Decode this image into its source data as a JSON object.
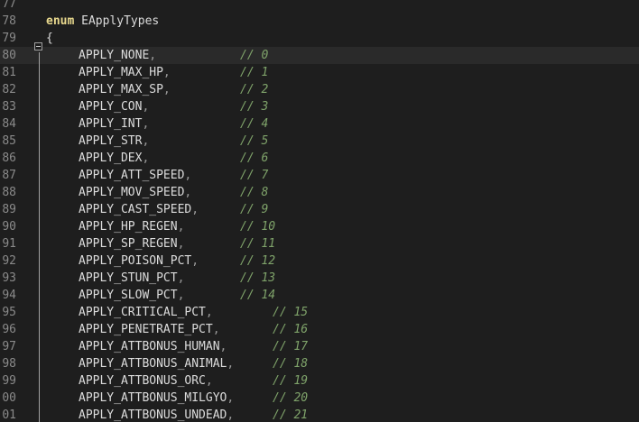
{
  "editor": {
    "colors": {
      "background": "#1e1e1e",
      "line_number": "#8a8a8a",
      "keyword": "#e9d98e",
      "identifier": "#dcdcdc",
      "comment": "#7fa36a"
    },
    "lines": [
      {
        "num": "77",
        "text": ""
      },
      {
        "num": "78",
        "keyword": "enum",
        "name": " EApplyTypes"
      },
      {
        "num": "79",
        "text": "{"
      },
      {
        "num": "80",
        "ident": "APPLY_NONE",
        "comment": "// 0"
      },
      {
        "num": "81",
        "ident": "APPLY_MAX_HP",
        "comment": "// 1"
      },
      {
        "num": "82",
        "ident": "APPLY_MAX_SP",
        "comment": "// 2"
      },
      {
        "num": "83",
        "ident": "APPLY_CON",
        "comment": "// 3"
      },
      {
        "num": "84",
        "ident": "APPLY_INT",
        "comment": "// 4"
      },
      {
        "num": "85",
        "ident": "APPLY_STR",
        "comment": "// 5"
      },
      {
        "num": "86",
        "ident": "APPLY_DEX",
        "comment": "// 6"
      },
      {
        "num": "87",
        "ident": "APPLY_ATT_SPEED",
        "comment": "// 7"
      },
      {
        "num": "88",
        "ident": "APPLY_MOV_SPEED",
        "comment": "// 8"
      },
      {
        "num": "89",
        "ident": "APPLY_CAST_SPEED",
        "comment": "// 9"
      },
      {
        "num": "90",
        "ident": "APPLY_HP_REGEN",
        "comment": "// 10"
      },
      {
        "num": "91",
        "ident": "APPLY_SP_REGEN",
        "comment": "// 11"
      },
      {
        "num": "92",
        "ident": "APPLY_POISON_PCT",
        "comment": "// 12"
      },
      {
        "num": "93",
        "ident": "APPLY_STUN_PCT",
        "comment": "// 13"
      },
      {
        "num": "94",
        "ident": "APPLY_SLOW_PCT",
        "comment": "// 14"
      },
      {
        "num": "95",
        "ident": "APPLY_CRITICAL_PCT",
        "comment": "// 15"
      },
      {
        "num": "96",
        "ident": "APPLY_PENETRATE_PCT",
        "comment": "// 16"
      },
      {
        "num": "97",
        "ident": "APPLY_ATTBONUS_HUMAN",
        "comment": "// 17"
      },
      {
        "num": "98",
        "ident": "APPLY_ATTBONUS_ANIMAL",
        "comment": "// 18"
      },
      {
        "num": "99",
        "ident": "APPLY_ATTBONUS_ORC",
        "comment": "// 19"
      },
      {
        "num": "00",
        "ident": "APPLY_ATTBONUS_MILGYO",
        "comment": "// 20"
      },
      {
        "num": "01",
        "ident": "APPLY_ATTBONUS_UNDEAD",
        "comment": "// 21"
      }
    ]
  }
}
